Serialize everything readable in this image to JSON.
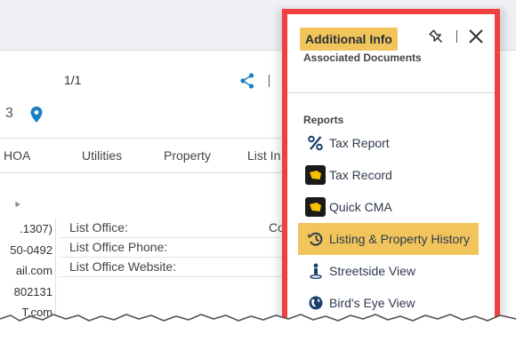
{
  "background": {
    "pager": "1/1",
    "id_fragment": "3",
    "tabs": [
      "HOA",
      "Utilities",
      "Property",
      "List In"
    ],
    "left_values": [
      ".1307)",
      "50-0492",
      "ail.com",
      "802131",
      "T.com"
    ],
    "office_rows": [
      {
        "label": "List Office:",
        "value": "Co"
      },
      {
        "label": "List Office Phone:",
        "value": ""
      },
      {
        "label": "List Office Website:",
        "value": ""
      }
    ]
  },
  "panel": {
    "title": "Additional Info",
    "subtitle": "Associated Documents",
    "section_label": "Reports",
    "items": [
      {
        "label": "Tax Report",
        "icon": "percent-icon",
        "selected": false
      },
      {
        "label": "Tax Record",
        "icon": "tax-record-map-icon",
        "selected": false
      },
      {
        "label": "Quick CMA",
        "icon": "quick-cma-map-icon",
        "selected": false
      },
      {
        "label": "Listing & Property History",
        "icon": "history-icon",
        "selected": true
      },
      {
        "label": "Streetside View",
        "icon": "streetside-person-icon",
        "selected": false
      },
      {
        "label": "Bird's Eye View",
        "icon": "globe-icon",
        "selected": false
      }
    ]
  },
  "colors": {
    "highlight": "#f1c55c",
    "panel_border": "#ef3f3f",
    "accent_blue": "#1b7fc4",
    "icon_dark": "#1a3f6b"
  }
}
